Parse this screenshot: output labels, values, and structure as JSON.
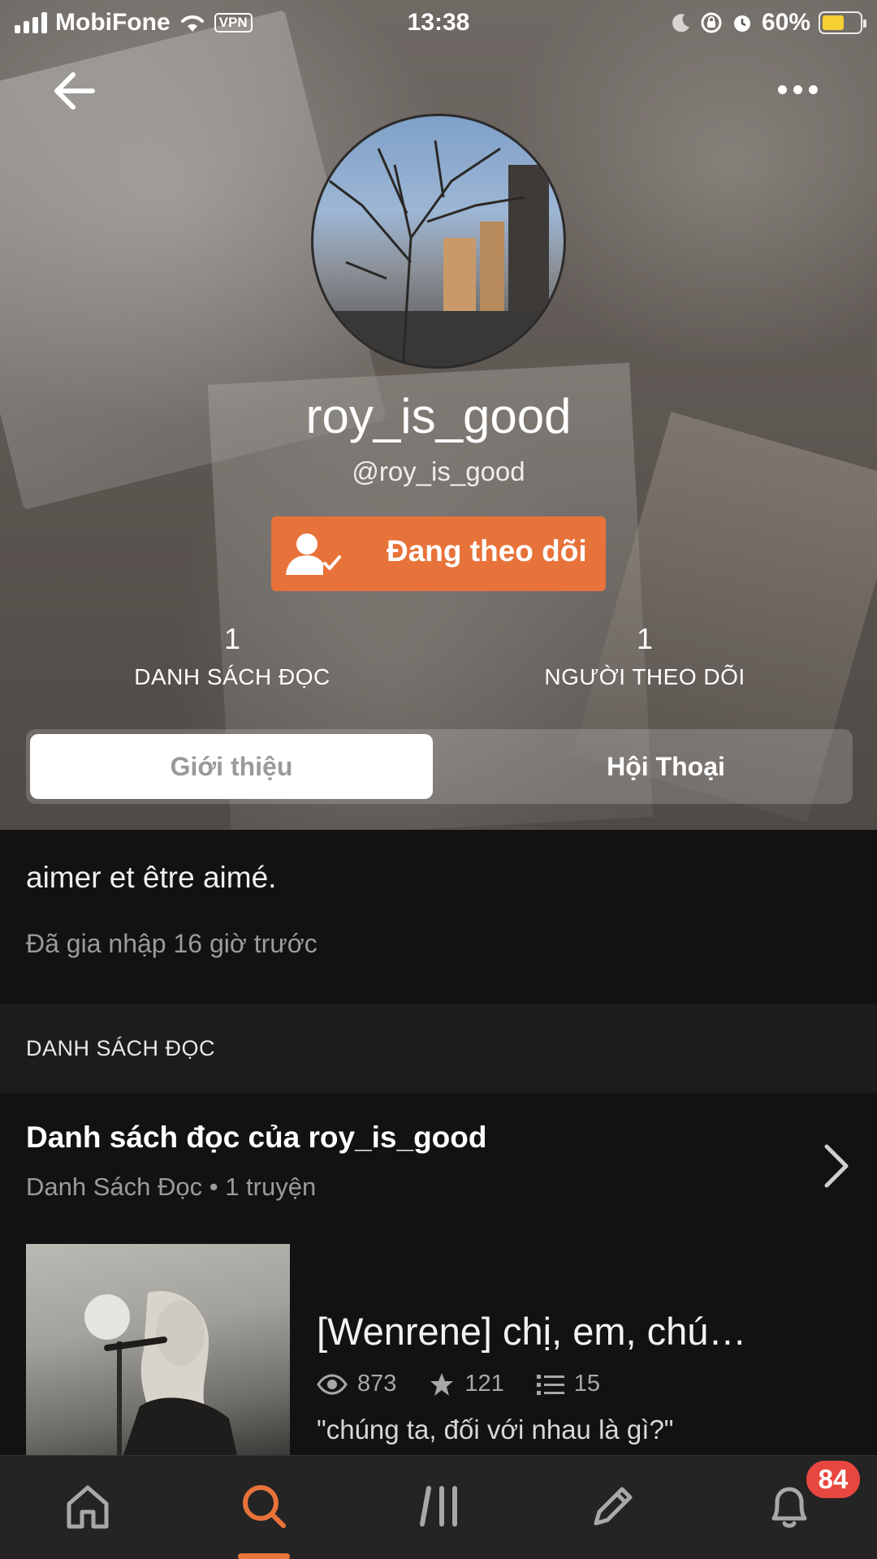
{
  "status_bar": {
    "carrier": "MobiFone",
    "vpn": "VPN",
    "time": "13:38",
    "battery": "60%",
    "battery_level": 0.6
  },
  "profile": {
    "display_name": "roy_is_good",
    "handle": "@roy_is_good",
    "follow_button_label": "Đang theo dõi",
    "stats": [
      {
        "value": "1",
        "label": "DANH SÁCH ĐỌC"
      },
      {
        "value": "1",
        "label": "NGƯỜI THEO DÕI"
      }
    ]
  },
  "tabs": [
    {
      "label": "Giới thiệu",
      "selected": true
    },
    {
      "label": "Hội Thoại",
      "selected": false
    }
  ],
  "about": {
    "bio": "aimer et être aimé.",
    "joined": "Đã gia nhập 16 giờ trước"
  },
  "reading_lists": {
    "section_title": "DANH SÁCH ĐỌC",
    "list_title": "Danh sách đọc của roy_is_good",
    "list_meta": "Danh Sách Đọc • 1 truyện",
    "story": {
      "title": "[Wenrene] chị, em, chú…",
      "views": "873",
      "votes": "121",
      "parts": "15",
      "description": "\"chúng ta, đối với nhau là gì?\""
    }
  },
  "bottom_nav": {
    "items": [
      "home-icon",
      "search-icon",
      "library-icon",
      "write-icon",
      "notifications-icon"
    ],
    "active": "search",
    "notification_badge": "84"
  },
  "colors": {
    "accent": "#e8733a",
    "badge": "#e8473f",
    "background": "#121212"
  }
}
